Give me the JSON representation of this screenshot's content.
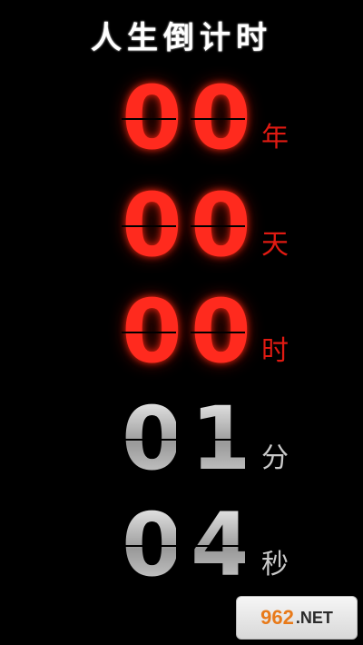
{
  "app": {
    "title": "人生倒计时"
  },
  "countdown": [
    {
      "digits": [
        "0",
        "0"
      ],
      "unit": "年",
      "color": "#ff2a1e"
    },
    {
      "digits": [
        "0",
        "0"
      ],
      "unit": "天",
      "color": "#ff2a1e"
    },
    {
      "digits": [
        "0",
        "0"
      ],
      "unit": "时",
      "color": "#ff2a1e"
    },
    {
      "digits": [
        "0",
        "1"
      ],
      "unit": "分",
      "color": "#c9c9c9"
    },
    {
      "digits": [
        "0",
        "4"
      ],
      "unit": "秒",
      "color": "#c9c9c9"
    }
  ],
  "watermark": {
    "brand": "962",
    "suffix": ".NET"
  }
}
